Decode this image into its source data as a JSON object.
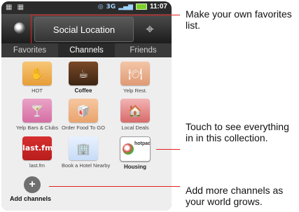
{
  "status": {
    "left_icons": "▦ ▦",
    "network": "3G",
    "time": "11:07"
  },
  "title_bar": {
    "title": "Social Location",
    "right_icon": "⌖"
  },
  "tabs": [
    {
      "label": "Favorites"
    },
    {
      "label": "Channels"
    },
    {
      "label": "Friends"
    }
  ],
  "channels": [
    {
      "label": "HOT",
      "icon": "✋"
    },
    {
      "label": "Coffee",
      "icon": "☕"
    },
    {
      "label": "Yelp Rest.",
      "icon": "🍽"
    },
    {
      "label": "Yelp Bars & Clubs",
      "icon": "🍸"
    },
    {
      "label": "Order Food To GO",
      "icon": "🥡"
    },
    {
      "label": "Local Deals",
      "icon": "🏠"
    },
    {
      "label": "last.fm",
      "tile_text": "last.fm"
    },
    {
      "label": "Book a Hotel Nearby",
      "icon": "🏢"
    },
    {
      "label": "Housing",
      "tile_text": "hotpads.com"
    }
  ],
  "add_channels": {
    "label": "Add channels",
    "icon": "+"
  },
  "callouts": {
    "favorites": "Make your own favorites list.",
    "collection": "Touch to see everything in in this collection.",
    "add": "Add more channels as your world grows."
  }
}
